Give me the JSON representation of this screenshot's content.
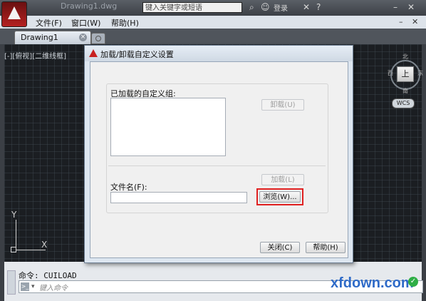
{
  "titlebar": {
    "title": "Drawing1.dwg",
    "search_placeholder": "键入关键字或短语",
    "user_label": "登录"
  },
  "menu": {
    "items": [
      "文件(F)",
      "窗口(W)",
      "帮助(H)"
    ]
  },
  "tabs": {
    "active": "Drawing1"
  },
  "viewport": {
    "label": "[-][俯视][二维线框]",
    "viewcube": {
      "face": "上",
      "north": "北",
      "south": "南",
      "east": "东",
      "west": "西"
    },
    "wcs": "WCS",
    "ucs_x": "X",
    "ucs_y": "Y"
  },
  "dialog": {
    "title": "加载/卸载自定义设置",
    "loaded_groups_label": "已加载的自定义组:",
    "unload_button": "卸载(U)",
    "load_button": "加载(L)",
    "filename_label": "文件名(F):",
    "filename_value": "",
    "browse_button": "浏览(W)...",
    "close_button": "关闭(C)",
    "help_button": "帮助(H)"
  },
  "command": {
    "history": "命令: CUILOAD",
    "placeholder": "键入命令"
  },
  "watermark": {
    "text": "xfdown.com"
  },
  "colors": {
    "canvas": "#1b1e22",
    "highlight": "#e02020",
    "brand": "#b52121",
    "watermark": "#2f6bc8"
  }
}
